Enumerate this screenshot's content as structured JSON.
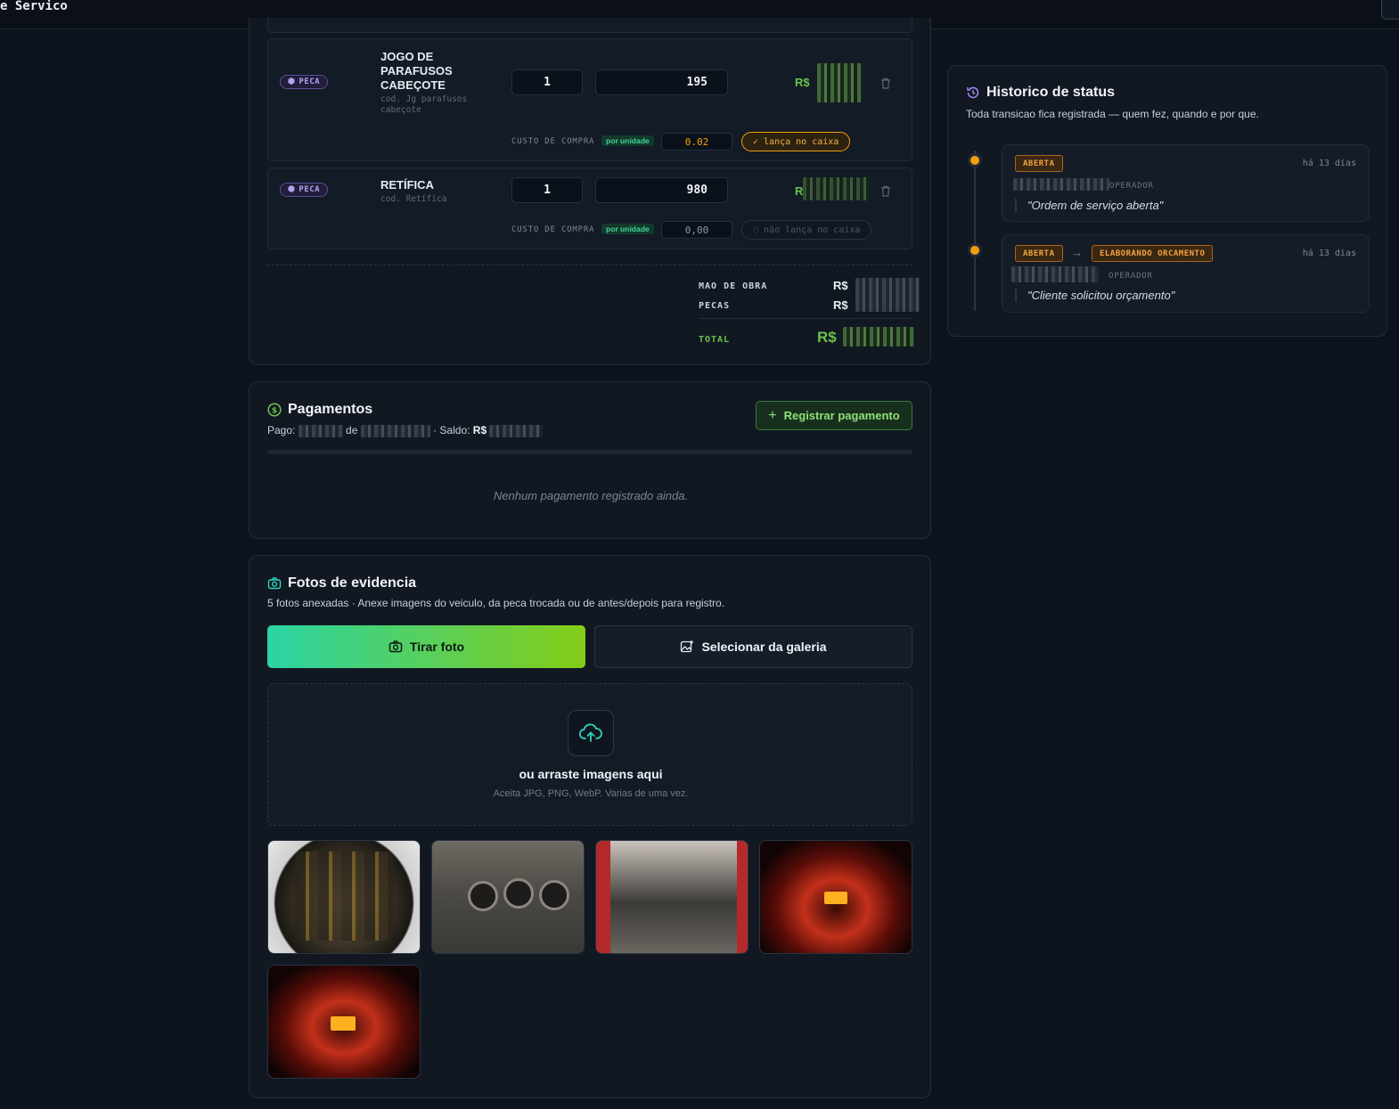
{
  "header": {
    "title": "e Servico"
  },
  "items": [
    {
      "type": "PECA",
      "name": "JOGO DE PARAFUSOS CABEÇOTE",
      "code": "cod. Jg parafusos cabeçote",
      "qty": "1",
      "price": "195",
      "currency": "R$",
      "custo_label": "CUSTO DE COMPRA",
      "por_unidade": "por unidade",
      "custo": "0.02",
      "lanca": "lança no caixa"
    },
    {
      "type": "PECA",
      "name": "RETÍFICA",
      "code": "cod. Retífica",
      "qty": "1",
      "price": "980",
      "currency": "R",
      "custo_label": "CUSTO DE COMPRA",
      "por_unidade": "por unidade",
      "custo": "0,00",
      "lanca": "não lança no caixa"
    }
  ],
  "summary": {
    "mao_label": "MAO DE OBRA",
    "pecas_label": "PECAS",
    "total_label": "TOTAL",
    "currency": "R$"
  },
  "payments": {
    "title": "Pagamentos",
    "pago_label": "Pago:",
    "de_label": "de",
    "saldo_label": "· Saldo:",
    "saldo_currency": "R$",
    "button": "Registrar pagamento",
    "empty": "Nenhum pagamento registrado ainda."
  },
  "photos": {
    "title": "Fotos de evidencia",
    "subtitle": "5 fotos anexadas · Anexe imagens do veiculo, da peca trocada ou de antes/depois para registro.",
    "take_button": "Tirar foto",
    "gallery_button": "Selecionar da galeria",
    "drop_title": "ou arraste imagens aqui",
    "drop_sub": "Aceita JPG, PNG, WebP. Varias de uma vez."
  },
  "history": {
    "title": "Historico de status",
    "subtitle": "Toda transicao fica registrada — quem fez, quando e por que.",
    "entries": [
      {
        "from": "ABERTA",
        "to": "",
        "role": "OPERADOR",
        "ago": "há 13 dias",
        "note": "\"Ordem de serviço aberta\""
      },
      {
        "from": "ABERTA",
        "arrow": "→",
        "to": "ELABORANDO ORCAMENTO",
        "role": "OPERADOR",
        "ago": "há 13 dias",
        "note": "\"Cliente solicitou orçamento\""
      }
    ]
  },
  "colors": {
    "accent_green": "#6cc24a",
    "status_orange": "#f59e0b",
    "peca_purple": "#b3a3f0",
    "teal": "#2dd4bf"
  }
}
